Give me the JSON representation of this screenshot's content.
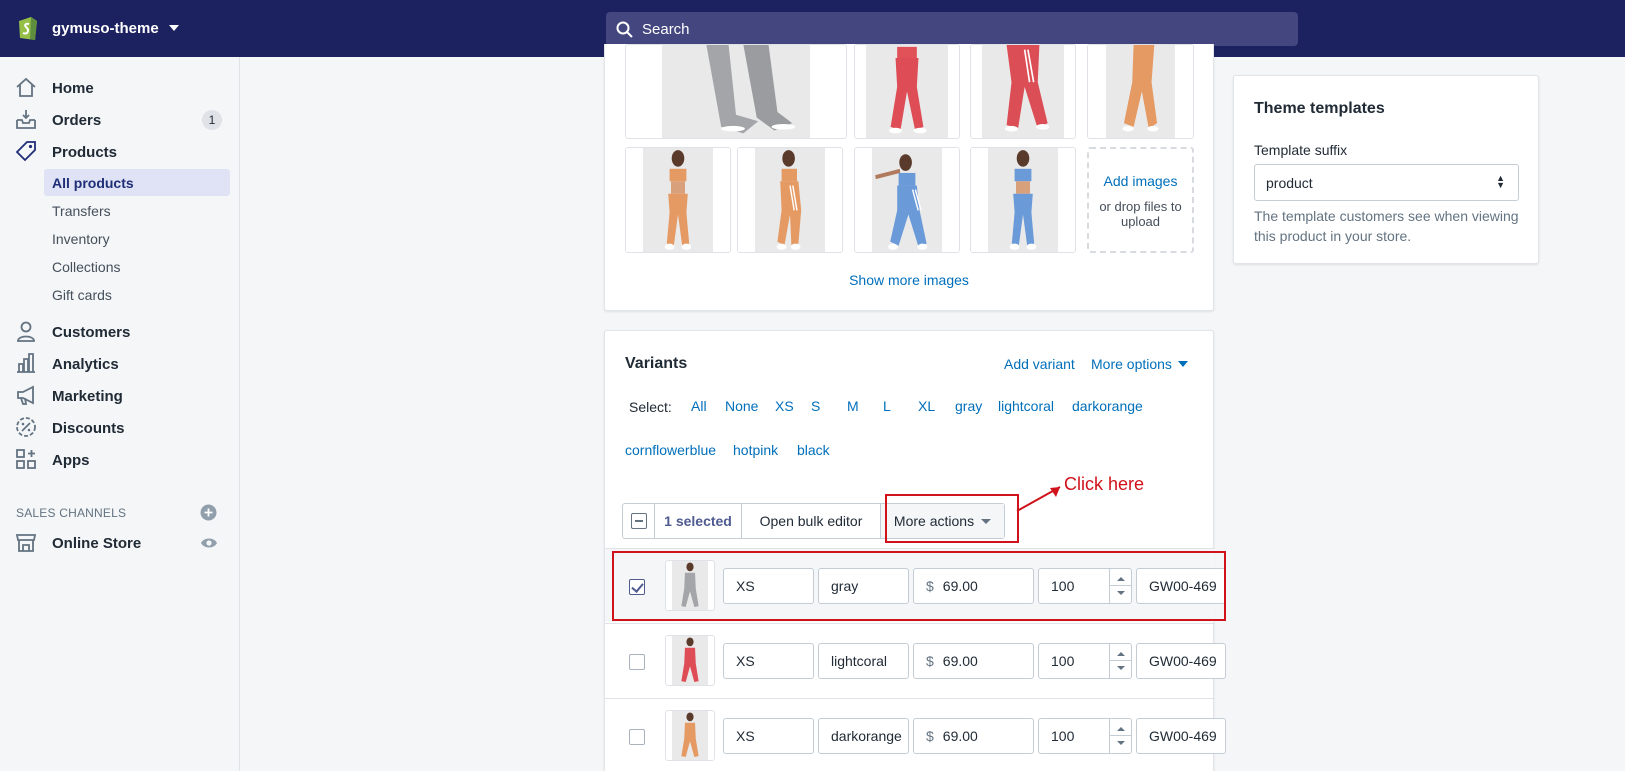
{
  "topbar": {
    "store_name": "gymuso-theme",
    "search_placeholder": "Search"
  },
  "sidebar": {
    "items": [
      {
        "label": "Home",
        "icon": "home-icon"
      },
      {
        "label": "Orders",
        "icon": "orders-icon",
        "badge": "1"
      },
      {
        "label": "Products",
        "icon": "tag-icon"
      },
      {
        "label": "Customers",
        "icon": "person-icon"
      },
      {
        "label": "Analytics",
        "icon": "bar-chart-icon"
      },
      {
        "label": "Marketing",
        "icon": "megaphone-icon"
      },
      {
        "label": "Discounts",
        "icon": "discount-icon"
      },
      {
        "label": "Apps",
        "icon": "apps-icon"
      }
    ],
    "products_sub": [
      "All products",
      "Transfers",
      "Inventory",
      "Collections",
      "Gift cards"
    ],
    "sales_channels_heading": "SALES CHANNELS",
    "online_store": "Online Store"
  },
  "media": {
    "add_images": "Add images",
    "drop_files": "or drop files to upload",
    "show_more": "Show more images"
  },
  "theme": {
    "title": "Theme templates",
    "suffix_label": "Template suffix",
    "suffix_value": "product",
    "help": "The template customers see when viewing this product in your store."
  },
  "variants": {
    "title": "Variants",
    "add_variant": "Add variant",
    "more_options": "More options",
    "select_label": "Select:",
    "select_options": [
      "All",
      "None",
      "XS",
      "S",
      "M",
      "L",
      "XL",
      "gray",
      "lightcoral",
      "darkorange",
      "cornflowerblue",
      "hotpink",
      "black"
    ],
    "bulk": {
      "selected": "1 selected",
      "open_bulk_editor": "Open bulk editor",
      "more_actions": "More actions"
    },
    "rows": [
      {
        "size": "XS",
        "color": "gray",
        "currency": "$",
        "price": "69.00",
        "qty": "100",
        "sku": "GW00-469",
        "checked": true
      },
      {
        "size": "XS",
        "color": "lightcoral",
        "currency": "$",
        "price": "69.00",
        "qty": "100",
        "sku": "GW00-469",
        "checked": false
      },
      {
        "size": "XS",
        "color": "darkorange",
        "currency": "$",
        "price": "69.00",
        "qty": "100",
        "sku": "GW00-469",
        "checked": false
      }
    ]
  },
  "annotation": {
    "text": "Click here",
    "color": "#d0121b"
  },
  "colors": {
    "topbar": "#1c2260",
    "link": "#006fbb",
    "selected_nav": "#202e78"
  }
}
